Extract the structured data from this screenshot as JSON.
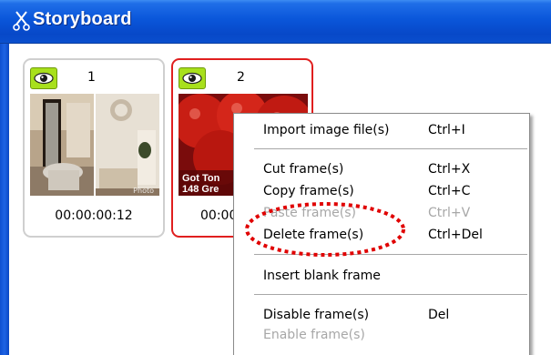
{
  "window": {
    "title": "Storyboard",
    "title_icon": "scissors-icon"
  },
  "frames": [
    {
      "number": "1",
      "timecode": "00:00:00:12",
      "visibility_icon": "eye-icon",
      "selected": false,
      "thumbnail": "room-interior-image",
      "thumbnail_caption": "Photo"
    },
    {
      "number": "2",
      "timecode": "00:00",
      "visibility_icon": "eye-icon",
      "selected": true,
      "thumbnail": "tomatoes-ad-image",
      "thumbnail_text": [
        "Got Ton",
        "148 Gre"
      ]
    }
  ],
  "context_menu": {
    "items": [
      {
        "label": "Import image file(s)",
        "shortcut": "Ctrl+I",
        "enabled": true
      },
      {
        "label": "Cut frame(s)",
        "shortcut": "Ctrl+X",
        "enabled": true
      },
      {
        "label": "Copy frame(s)",
        "shortcut": "Ctrl+C",
        "enabled": true
      },
      {
        "label": "Paste frame(s)",
        "shortcut": "Ctrl+V",
        "enabled": false
      },
      {
        "label": "Delete frame(s)",
        "shortcut": "Ctrl+Del",
        "enabled": true,
        "highlighted": true
      },
      {
        "label": "Insert blank frame",
        "shortcut": "",
        "enabled": true
      },
      {
        "label": "Disable frame(s)",
        "shortcut": "Del",
        "enabled": true
      },
      {
        "label": "Enable frame(s)",
        "shortcut": "",
        "enabled": false
      }
    ]
  },
  "colors": {
    "title_bar": "#0a56da",
    "selected_border": "#e01f1f",
    "highlight_ellipse": "#e00000",
    "eye_badge": "#a8e01c"
  }
}
